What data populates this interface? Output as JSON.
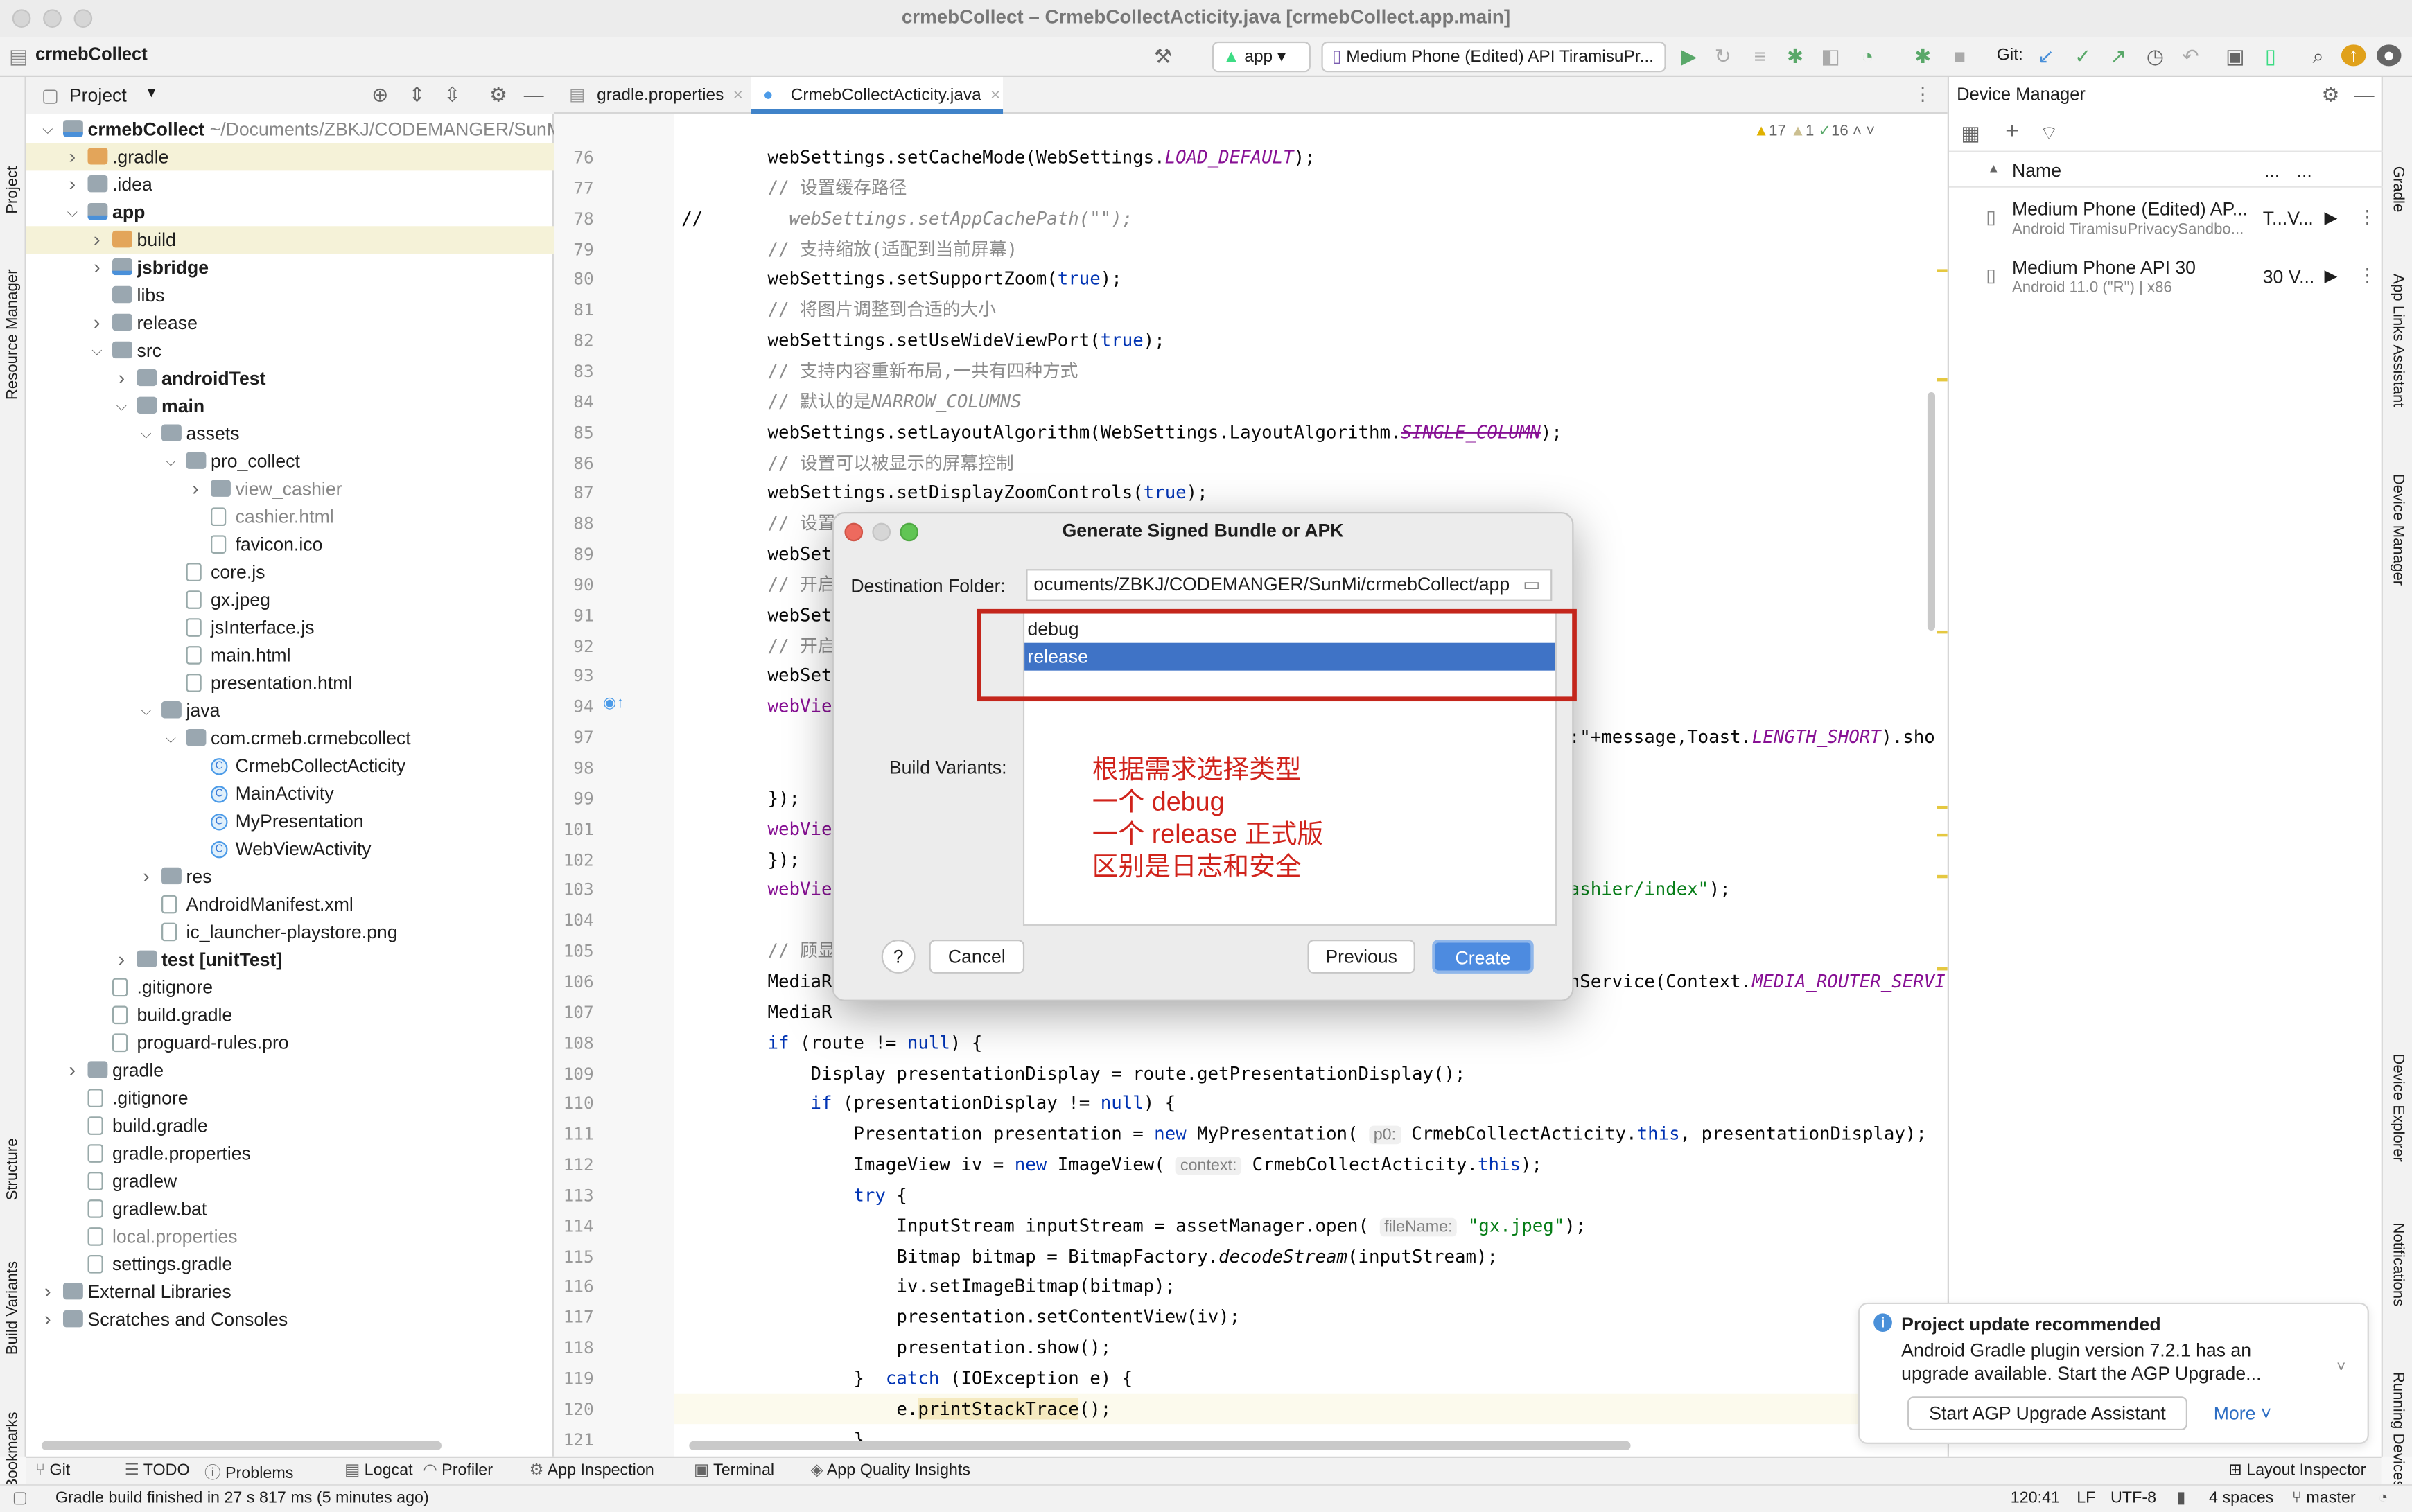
{
  "window": {
    "title": "crmebCollect – CrmebCollectActicity.java [crmebCollect.app.main]"
  },
  "toolbar": {
    "project": "crmebCollect",
    "run_config": "app",
    "device": "Medium Phone (Edited) API TiramisuPr...",
    "git_label": "Git:"
  },
  "left_strip": [
    "Project",
    "Resource Manager",
    "Structure",
    "Build Variants",
    "Bookmarks"
  ],
  "right_strip": [
    "Gradle",
    "App Links Assistant",
    "Device Manager",
    "Device Explorer",
    "Notifications",
    "Running Devices"
  ],
  "project_panel": {
    "title": "Project",
    "tree": [
      {
        "label": "crmebCollect",
        "suffix": " ~/Documents/ZBKJ/CODEMANGER/SunMi",
        "depth": 0,
        "arrow": "open",
        "icon": "module-folder",
        "bold": true
      },
      {
        "label": ".gradle",
        "depth": 1,
        "arrow": "closed",
        "icon": "excluded-folder",
        "hl": true
      },
      {
        "label": ".idea",
        "depth": 1,
        "arrow": "closed",
        "icon": "folder"
      },
      {
        "label": "app",
        "depth": 1,
        "arrow": "open",
        "icon": "module-folder",
        "bold": true
      },
      {
        "label": "build",
        "depth": 2,
        "arrow": "closed",
        "icon": "excluded-folder",
        "hl": true
      },
      {
        "label": "jsbridge",
        "depth": 2,
        "arrow": "closed",
        "icon": "module-folder",
        "bold": true
      },
      {
        "label": "libs",
        "depth": 2,
        "icon": "folder"
      },
      {
        "label": "release",
        "depth": 2,
        "arrow": "closed",
        "icon": "folder"
      },
      {
        "label": "src",
        "depth": 2,
        "arrow": "open",
        "icon": "folder"
      },
      {
        "label": "androidTest",
        "depth": 3,
        "arrow": "closed",
        "icon": "folder",
        "bold": true
      },
      {
        "label": "main",
        "depth": 3,
        "arrow": "open",
        "icon": "folder",
        "bold": true
      },
      {
        "label": "assets",
        "depth": 4,
        "arrow": "open",
        "icon": "folder"
      },
      {
        "label": "pro_collect",
        "depth": 5,
        "arrow": "open",
        "icon": "folder"
      },
      {
        "label": "view_cashier",
        "depth": 6,
        "arrow": "closed",
        "icon": "folder",
        "gray": true
      },
      {
        "label": "cashier.html",
        "depth": 6,
        "icon": "html-file",
        "gray": true
      },
      {
        "label": "favicon.ico",
        "depth": 6,
        "icon": "file"
      },
      {
        "label": "core.js",
        "depth": 5,
        "icon": "js-file"
      },
      {
        "label": "gx.jpeg",
        "depth": 5,
        "icon": "image-file"
      },
      {
        "label": "jsInterface.js",
        "depth": 5,
        "icon": "js-file"
      },
      {
        "label": "main.html",
        "depth": 5,
        "icon": "html-file"
      },
      {
        "label": "presentation.html",
        "depth": 5,
        "icon": "html-file"
      },
      {
        "label": "java",
        "depth": 4,
        "arrow": "open",
        "icon": "source-folder"
      },
      {
        "label": "com.crmeb.crmebcollect",
        "depth": 5,
        "arrow": "open",
        "icon": "package"
      },
      {
        "label": "CrmebCollectActicity",
        "depth": 6,
        "icon": "class"
      },
      {
        "label": "MainActivity",
        "depth": 6,
        "icon": "class"
      },
      {
        "label": "MyPresentation",
        "depth": 6,
        "icon": "class"
      },
      {
        "label": "WebViewActivity",
        "depth": 6,
        "icon": "class"
      },
      {
        "label": "res",
        "depth": 4,
        "arrow": "closed",
        "icon": "folder"
      },
      {
        "label": "AndroidManifest.xml",
        "depth": 4,
        "icon": "manifest-file"
      },
      {
        "label": "ic_launcher-playstore.png",
        "depth": 4,
        "icon": "image-file"
      },
      {
        "label": "test [unitTest]",
        "depth": 3,
        "arrow": "closed",
        "icon": "folder",
        "bold": true
      },
      {
        "label": ".gitignore",
        "depth": 2,
        "icon": "file"
      },
      {
        "label": "build.gradle",
        "depth": 2,
        "icon": "gradle-file"
      },
      {
        "label": "proguard-rules.pro",
        "depth": 2,
        "icon": "file"
      },
      {
        "label": "gradle",
        "depth": 1,
        "arrow": "closed",
        "icon": "folder"
      },
      {
        "label": ".gitignore",
        "depth": 1,
        "icon": "file"
      },
      {
        "label": "build.gradle",
        "depth": 1,
        "icon": "gradle-file"
      },
      {
        "label": "gradle.properties",
        "depth": 1,
        "icon": "file"
      },
      {
        "label": "gradlew",
        "depth": 1,
        "icon": "file"
      },
      {
        "label": "gradlew.bat",
        "depth": 1,
        "icon": "file"
      },
      {
        "label": "local.properties",
        "depth": 1,
        "icon": "file",
        "gray": true
      },
      {
        "label": "settings.gradle",
        "depth": 1,
        "icon": "gradle-file"
      },
      {
        "label": "External Libraries",
        "depth": 0,
        "arrow": "closed",
        "icon": "library"
      },
      {
        "label": "Scratches and Consoles",
        "depth": 0,
        "arrow": "closed",
        "icon": "scratch"
      }
    ]
  },
  "editor": {
    "tabs": [
      {
        "label": "gradle.properties",
        "active": false
      },
      {
        "label": "CrmebCollectActicity.java",
        "active": true
      }
    ],
    "inspections": {
      "errors": "17",
      "warnings": "1",
      "ok": "16"
    },
    "current_line": 120,
    "lines": [
      {
        "n": 76,
        "t": [
          [
            "webSettings.setCacheMode(WebSettings.",
            ""
          ],
          [
            "LOAD_DEFAULT",
            "f"
          ],
          [
            ");",
            ""
          ]
        ]
      },
      {
        "n": 77,
        "t": [
          [
            "// 设置缓存路径",
            "c"
          ]
        ]
      },
      {
        "n": 78,
        "t": [
          [
            "//",
            "gut"
          ],
          [
            "  webSettings.setAppCachePath(\"\");",
            "ci"
          ]
        ]
      },
      {
        "n": 79,
        "t": [
          [
            "// 支持缩放(适配到当前屏幕)",
            "c"
          ]
        ]
      },
      {
        "n": 80,
        "t": [
          [
            "webSettings.setSupportZoom(",
            ""
          ],
          [
            "true",
            "k"
          ],
          [
            ");",
            ""
          ]
        ]
      },
      {
        "n": 81,
        "t": [
          [
            "// 将图片调整到合适的大小",
            "c"
          ]
        ]
      },
      {
        "n": 82,
        "t": [
          [
            "webSettings.setUseWideViewPort(",
            ""
          ],
          [
            "true",
            "k"
          ],
          [
            ");",
            ""
          ]
        ]
      },
      {
        "n": 83,
        "t": [
          [
            "// 支持内容重新布局,一共有四种方式",
            "c"
          ]
        ]
      },
      {
        "n": 84,
        "t": [
          [
            "// 默认的是",
            "c"
          ],
          [
            "NARROW_COLUMNS",
            "ci"
          ]
        ]
      },
      {
        "n": 85,
        "t": [
          [
            "webSettings.setLayoutAlgorithm(WebSettings.LayoutAlgorithm.",
            ""
          ],
          [
            "SINGLE_COLUMN",
            "st"
          ],
          [
            ");",
            ""
          ]
        ]
      },
      {
        "n": 86,
        "t": [
          [
            "// 设置可以被显示的屏幕控制",
            "c"
          ]
        ]
      },
      {
        "n": 87,
        "t": [
          [
            "webSettings.setDisplayZoomControls(",
            ""
          ],
          [
            "true",
            "k"
          ],
          [
            ");",
            ""
          ]
        ]
      },
      {
        "n": 88,
        "t": [
          [
            "// 设置默认字体大小",
            "c"
          ]
        ]
      },
      {
        "n": 89,
        "t": [
          [
            "webSet",
            ""
          ]
        ]
      },
      {
        "n": 90,
        "t": [
          [
            "// 开启",
            "c"
          ]
        ]
      },
      {
        "n": 91,
        "t": [
          [
            "webSet",
            ""
          ]
        ]
      },
      {
        "n": 92,
        "t": [
          [
            "// 开启",
            "c"
          ]
        ]
      },
      {
        "n": 93,
        "t": [
          [
            "webSet",
            ""
          ]
        ]
      },
      {
        "n": 94,
        "t": [
          [
            "webVie",
            "p"
          ]
        ]
      },
      {
        "n": 97,
        "t": [
          [
            ":\"+message,Toast.",
            "r"
          ],
          [
            "LENGTH_SHORT",
            "f r2"
          ],
          [
            ").sho",
            "r3"
          ]
        ]
      },
      {
        "n": 98,
        "t": []
      },
      {
        "n": 99,
        "t": [
          [
            "});",
            ""
          ]
        ]
      },
      {
        "n": 101,
        "t": [
          [
            "webVie",
            "p"
          ]
        ]
      },
      {
        "n": 102,
        "t": [
          [
            "});",
            ""
          ]
        ]
      },
      {
        "n": 103,
        "t": [
          [
            "webVie",
            "p"
          ],
          [
            "ashier/index\"",
            "s r"
          ],
          [
            ");",
            "r4"
          ]
        ]
      },
      {
        "n": 104,
        "t": []
      },
      {
        "n": 105,
        "t": [
          [
            "// 顾显",
            "c"
          ]
        ]
      },
      {
        "n": 106,
        "t": [
          [
            "MediaR",
            ""
          ],
          [
            "nService(Context.",
            "r"
          ],
          [
            "MEDIA_ROUTER_SERVI",
            "f r5"
          ]
        ]
      },
      {
        "n": 107,
        "t": [
          [
            "MediaR",
            ""
          ]
        ]
      },
      {
        "n": 108,
        "t": [
          [
            "if",
            "k"
          ],
          [
            " (route != ",
            ""
          ],
          [
            "null",
            "k"
          ],
          [
            ") {",
            ""
          ]
        ]
      },
      {
        "n": 109,
        "t": [
          [
            "    Display presentationDisplay = route.getPresentationDisplay();",
            ""
          ]
        ]
      },
      {
        "n": 110,
        "t": [
          [
            "    ",
            ""
          ],
          [
            "if",
            "k"
          ],
          [
            " (presentationDisplay != ",
            ""
          ],
          [
            "null",
            "k"
          ],
          [
            ") {",
            ""
          ]
        ]
      },
      {
        "n": 111,
        "t": [
          [
            "        Presentation presentation = ",
            ""
          ],
          [
            "new",
            "k"
          ],
          [
            " MyPresentation( ",
            ""
          ],
          [
            "p0:",
            "h"
          ],
          [
            " CrmebCollectActicity.",
            ""
          ],
          [
            "this",
            "k"
          ],
          [
            ", presentationDisplay);",
            ""
          ]
        ]
      },
      {
        "n": 112,
        "t": [
          [
            "        ImageView iv = ",
            ""
          ],
          [
            "new",
            "k"
          ],
          [
            " ImageView( ",
            ""
          ],
          [
            "context:",
            "h"
          ],
          [
            " CrmebCollectActicity.",
            ""
          ],
          [
            "this",
            "k"
          ],
          [
            ");",
            ""
          ]
        ]
      },
      {
        "n": 113,
        "t": [
          [
            "        ",
            ""
          ],
          [
            "try",
            "k"
          ],
          [
            " {",
            ""
          ]
        ]
      },
      {
        "n": 114,
        "t": [
          [
            "            InputStream inputStream = assetManager.open( ",
            ""
          ],
          [
            "fileName:",
            "h"
          ],
          [
            " ",
            ""
          ],
          [
            "\"gx.jpeg\"",
            "s"
          ],
          [
            ");",
            ""
          ]
        ]
      },
      {
        "n": 115,
        "t": [
          [
            "            Bitmap bitmap = BitmapFactory.",
            ""
          ],
          [
            "decodeStream",
            "i"
          ],
          [
            "(inputStream);",
            ""
          ]
        ]
      },
      {
        "n": 116,
        "t": [
          [
            "            iv.setImageBitmap(bitmap);",
            ""
          ]
        ]
      },
      {
        "n": 117,
        "t": [
          [
            "            presentation.setContentView(iv);",
            ""
          ]
        ]
      },
      {
        "n": 118,
        "t": [
          [
            "            presentation.show();",
            ""
          ]
        ]
      },
      {
        "n": 119,
        "t": [
          [
            "        }  ",
            ""
          ],
          [
            "catch",
            "k"
          ],
          [
            " (IOException e) {",
            ""
          ]
        ]
      },
      {
        "n": 120,
        "t": [
          [
            "            e.",
            ""
          ],
          [
            "printStackTrace",
            "hl"
          ],
          [
            "();",
            ""
          ]
        ]
      },
      {
        "n": 121,
        "t": [
          [
            "        }",
            ""
          ]
        ]
      },
      {
        "n": 122,
        "t": []
      }
    ]
  },
  "device_manager": {
    "title": "Device Manager",
    "col_name": "Name",
    "col_more1": "...",
    "col_more2": "...",
    "devices": [
      {
        "name": "Medium Phone (Edited) AP...",
        "sub": "Android TiramisuPrivacySandbo...",
        "api": "T...V..."
      },
      {
        "name": "Medium Phone API 30",
        "sub": "Android 11.0 (\"R\") | x86",
        "api": "30 V..."
      }
    ]
  },
  "dialog": {
    "title": "Generate Signed Bundle or APK",
    "dest_label": "Destination Folder:",
    "dest_value": "ocuments/ZBKJ/CODEMANGER/SunMi/crmebCollect/app",
    "variants_label": "Build Variants:",
    "variants": [
      "debug",
      "release"
    ],
    "selected": "release",
    "annotation": [
      "根据需求选择类型",
      "一个 debug",
      "一个 release 正式版",
      "区别是日志和安全"
    ],
    "annotation_color": "#d0231b",
    "help": "?",
    "cancel": "Cancel",
    "previous": "Previous",
    "create": "Create"
  },
  "notification": {
    "title": "Project update recommended",
    "body": "Android Gradle plugin version 7.2.1 has an upgrade available. Start the AGP Upgrade...",
    "button": "Start AGP Upgrade Assistant",
    "more": "More"
  },
  "bottom_tools": [
    "Git",
    "TODO",
    "Problems",
    "Logcat",
    "Profiler",
    "App Inspection",
    "Terminal",
    "App Quality Insights"
  ],
  "bottom_right": "Layout Inspector",
  "status": {
    "message": "Gradle build finished in 27 s 817 ms (5 minutes ago)",
    "position": "120:41",
    "line_sep": "LF",
    "encoding": "UTF-8",
    "indent": "4 spaces",
    "branch": "master"
  }
}
